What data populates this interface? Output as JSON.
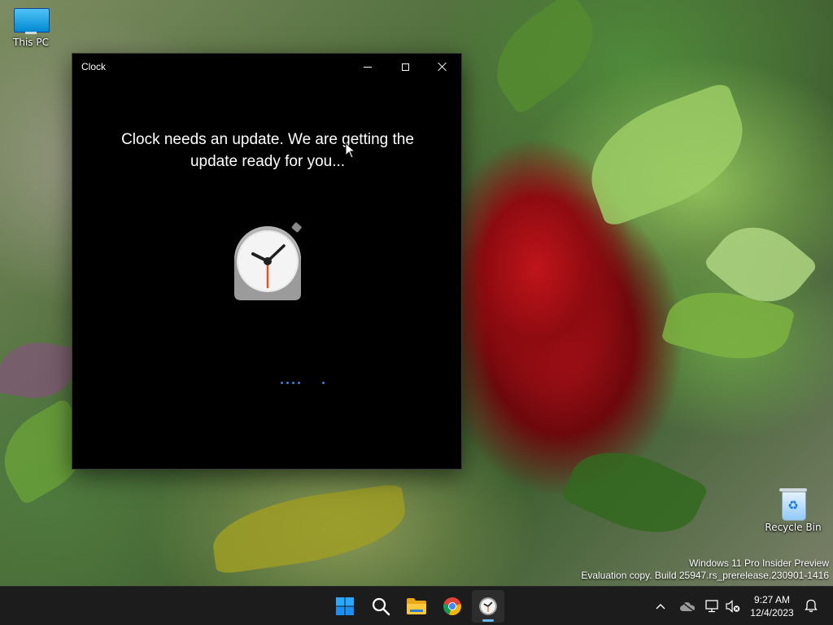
{
  "desktop": {
    "icons": [
      {
        "label": "This PC",
        "icon": "this-pc-icon"
      },
      {
        "label": "Recycle Bin",
        "icon": "recycle-bin-icon"
      }
    ],
    "watermark": {
      "line1": "Windows 11 Pro Insider Preview",
      "line2": "Evaluation copy. Build 25947.rs_prerelease.230901-1416"
    }
  },
  "window": {
    "title": "Clock",
    "message": "Clock needs an update. We are getting the update ready for you...",
    "app_icon": "alarm-clock-icon",
    "controls": [
      "minimize-icon",
      "maximize-icon",
      "close-icon"
    ]
  },
  "taskbar": {
    "apps": [
      {
        "name": "Start",
        "icon": "windows-start-icon"
      },
      {
        "name": "Search",
        "icon": "search-icon"
      },
      {
        "name": "File Explorer",
        "icon": "folder-icon"
      },
      {
        "name": "Google Chrome",
        "icon": "chrome-icon"
      },
      {
        "name": "Clock",
        "icon": "clock-icon",
        "active": true
      }
    ],
    "tray": {
      "icons": [
        "chevron-up-icon",
        "onedrive-icon",
        "network-icon",
        "volume-muted-icon",
        "notification-bell-icon"
      ],
      "time": "9:27 AM",
      "date": "12/4/2023"
    }
  },
  "colors": {
    "accent": "#0078d4",
    "taskbar_bg": "#1c1c1c",
    "window_bg": "#000000",
    "progress_dot": "#3f7fd8"
  }
}
